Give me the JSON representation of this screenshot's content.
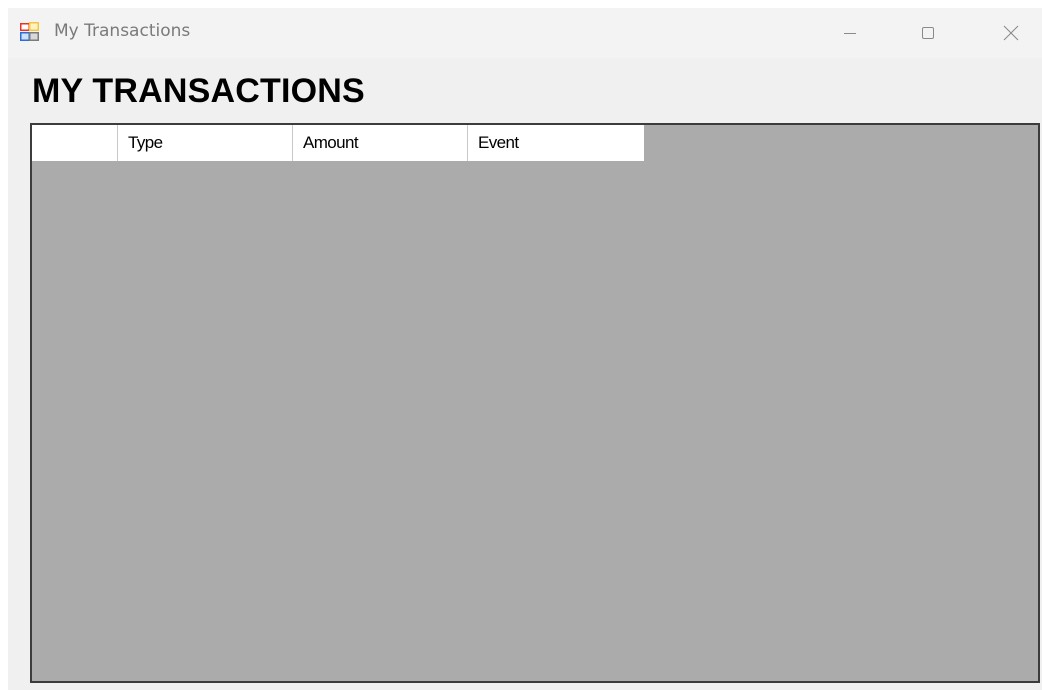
{
  "window": {
    "title": "My Transactions",
    "icon": "windows-form-app-icon",
    "controls": {
      "minimize": "minimize-icon",
      "maximize": "maximize-icon",
      "close": "close-icon"
    }
  },
  "form": {
    "heading": "MY TRANSACTIONS"
  },
  "grid": {
    "columns": [
      "Type",
      "Amount",
      "Event"
    ],
    "rows": [],
    "background_color": "#ababab"
  }
}
